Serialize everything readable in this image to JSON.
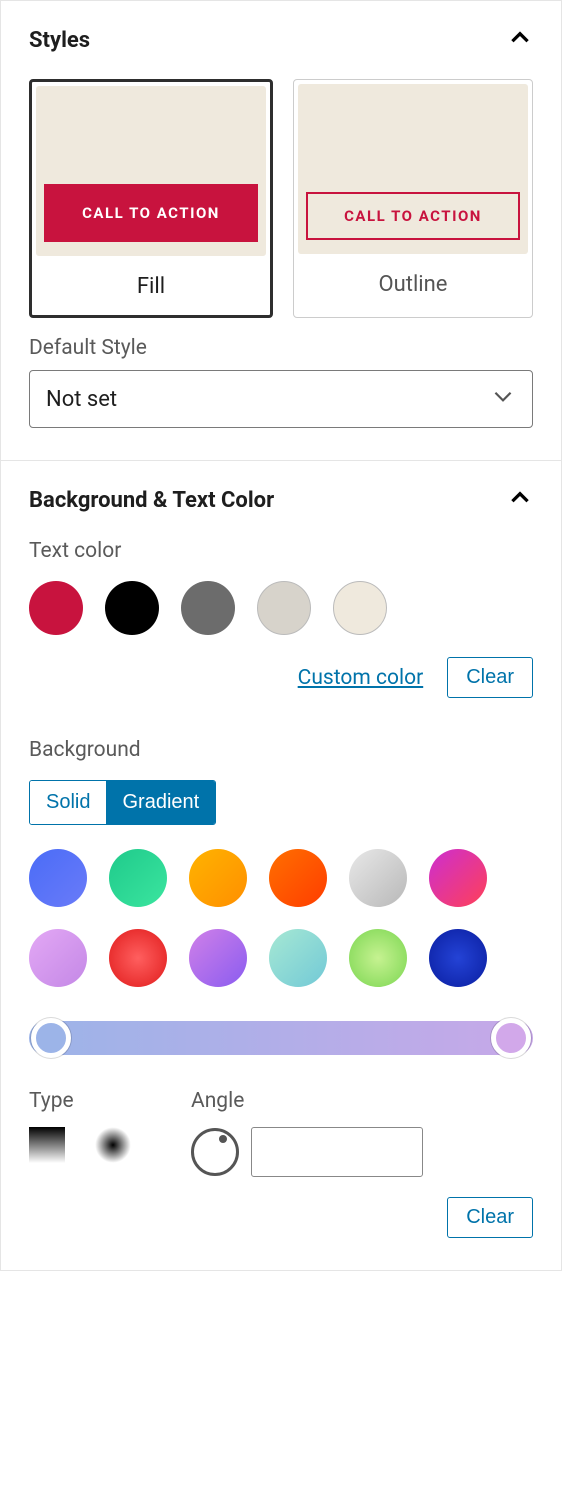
{
  "styles": {
    "title": "Styles",
    "cta_text": "CALL TO ACTION",
    "fill_label": "Fill",
    "outline_label": "Outline",
    "default_style_label": "Default Style",
    "default_style_value": "Not set"
  },
  "colors": {
    "title": "Background & Text Color",
    "text_color_label": "Text color",
    "text_swatches": [
      {
        "color": "#c8133e",
        "bordered": false
      },
      {
        "color": "#000000",
        "bordered": false
      },
      {
        "color": "#6c6c6c",
        "bordered": false
      },
      {
        "color": "#d7d3cb",
        "bordered": true
      },
      {
        "color": "#efe9dd",
        "bordered": true
      }
    ],
    "custom_color_link": "Custom color",
    "clear_label": "Clear",
    "background_label": "Background",
    "seg_solid": "Solid",
    "seg_gradient": "Gradient",
    "gradient_swatches": [
      "linear-gradient(135deg,#4a6cf7,#6a7bf8)",
      "linear-gradient(135deg,#1fca8b,#3be59f)",
      "linear-gradient(135deg,#ffb300,#ff8f00)",
      "linear-gradient(135deg,#ff6f00,#ff3d00)",
      "linear-gradient(135deg,#e8e8e8,#b8b8b8)",
      "linear-gradient(135deg,#cc2ed1,#ff4057)",
      "linear-gradient(135deg,#e3a8f5,#c488e6)",
      "radial-gradient(circle,#ff5f5f,#e01b1b)",
      "linear-gradient(135deg,#d080e8,#8a5cf0)",
      "linear-gradient(135deg,#a6e8d4,#72c9d6)",
      "radial-gradient(circle,#c6f291,#7bd651)",
      "radial-gradient(circle,#2443d6,#0a1ea0)"
    ],
    "type_label": "Type",
    "angle_label": "Angle",
    "angle_value": ""
  }
}
